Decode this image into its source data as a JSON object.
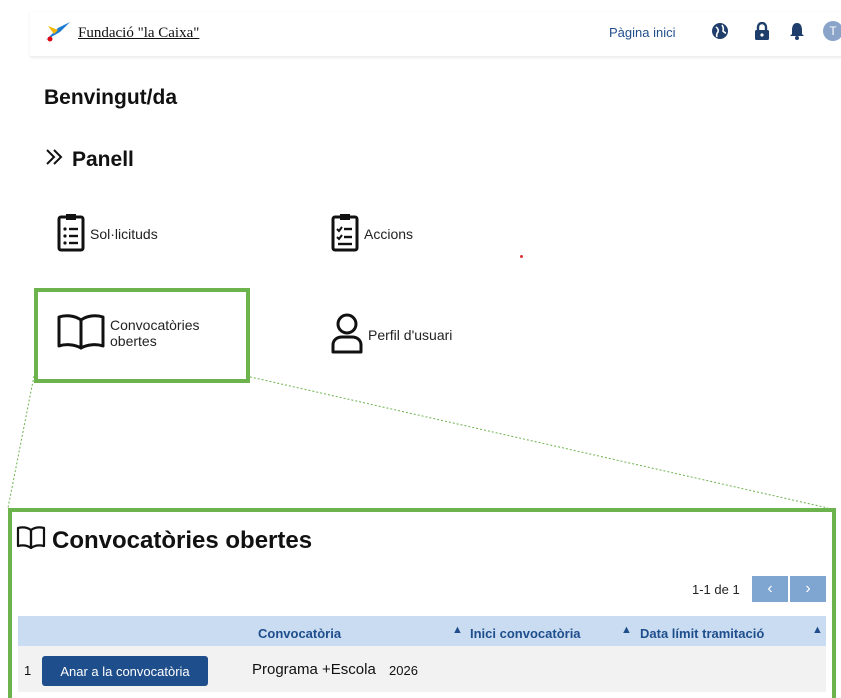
{
  "header": {
    "logo_text": "Fundació \"la Caixa\"",
    "home_link": "Pàgina inici",
    "icons": [
      "globe-icon",
      "lock-icon",
      "bell-icon"
    ],
    "avatar_initial": "T"
  },
  "welcome": "Benvingut/da",
  "panel": {
    "title": "Panell",
    "tiles": {
      "sollicituds": "Sol·licituds",
      "accions": "Accions",
      "convocatories_line1": "Convocatòries",
      "convocatories_line2": "obertes",
      "perfil": "Perfil d'usuari"
    }
  },
  "zoom": {
    "title": "Convocatòries obertes",
    "pager_text": "1-1 de 1",
    "pager_prev": "‹",
    "pager_next": "›",
    "columns": [
      "Convocatòria",
      "Inici convocatòria",
      "Data límit tramitació"
    ],
    "rows": [
      {
        "index": "1",
        "action": "Anar a la convocatòria",
        "name": "Programa +Escola",
        "year": "2026"
      }
    ]
  },
  "colors": {
    "highlight": "#6db34d",
    "primary": "#1f4e8c",
    "table_header": "#c9dcf1"
  }
}
